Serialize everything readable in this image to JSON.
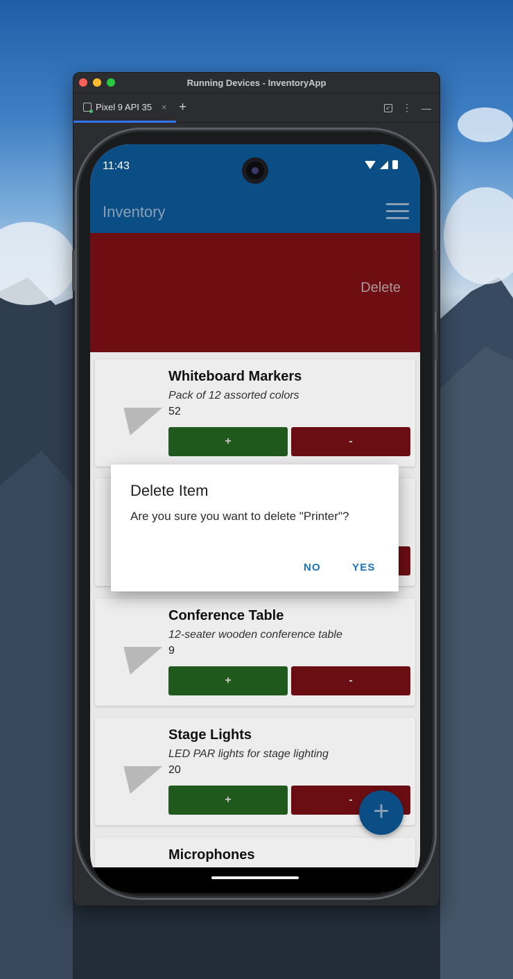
{
  "window": {
    "title": "Running Devices - InventoryApp",
    "tab_label": "Pixel 9 API 35",
    "tab_close": "×",
    "tab_add": "+"
  },
  "status_bar": {
    "time": "11:43"
  },
  "app_bar": {
    "title": "Inventory"
  },
  "swipe_action": {
    "label": "Delete"
  },
  "items": [
    {
      "title": "Whiteboard Markers",
      "description": "Pack of 12 assorted colors",
      "quantity": "52",
      "plus": "+",
      "minus": "-"
    },
    {
      "title": "",
      "description": "",
      "quantity": "",
      "plus": "+",
      "minus": "-"
    },
    {
      "title": "Conference Table",
      "description": "12-seater wooden conference table",
      "quantity": "9",
      "plus": "+",
      "minus": "-"
    },
    {
      "title": "Stage Lights",
      "description": "LED PAR lights for stage lighting",
      "quantity": "20",
      "plus": "+",
      "minus": "-"
    },
    {
      "title": "Microphones",
      "description": "",
      "quantity": "",
      "plus": "+",
      "minus": "-"
    }
  ],
  "fab": {
    "label": "+"
  },
  "dialog": {
    "title": "Delete Item",
    "message": "Are you sure you want to delete \"Printer\"?",
    "no_label": "NO",
    "yes_label": "YES"
  }
}
